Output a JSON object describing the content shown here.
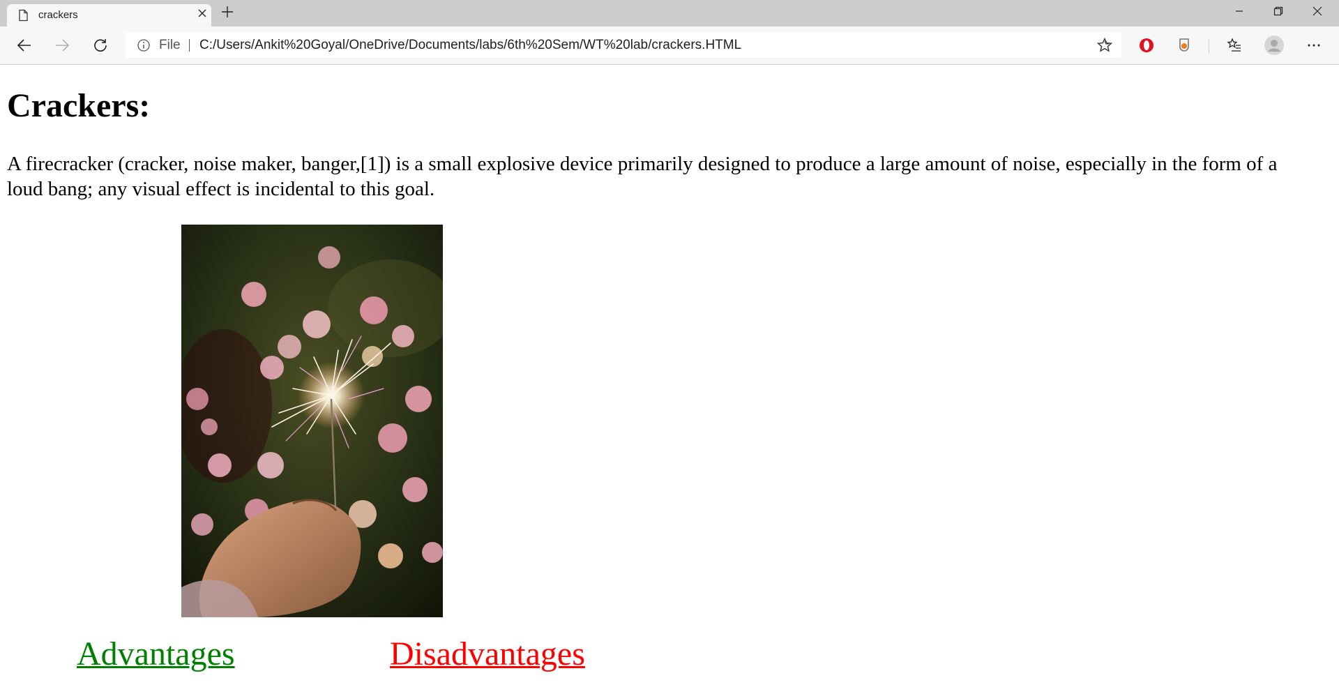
{
  "browser": {
    "tab_title": "crackers",
    "scheme_label": "File",
    "url": "C:/Users/Ankit%20Goyal/OneDrive/Documents/labs/6th%20Sem/WT%20lab/crackers.HTML"
  },
  "page": {
    "heading": "Crackers:",
    "description": "A firecracker (cracker, noise maker, banger,[1]) is a small explosive device primarily designed to produce a large amount of noise, especially in the form of a loud bang; any visual effect is incidental to this goal.",
    "links": {
      "advantages": "Advantages ",
      "disadvantages": "Disadvantages"
    }
  },
  "colors": {
    "advantages_link": "#008000",
    "disadvantages_link": "#ff0000",
    "opera_icon": "#e1121f",
    "extension_icon": "#f07c1c"
  }
}
